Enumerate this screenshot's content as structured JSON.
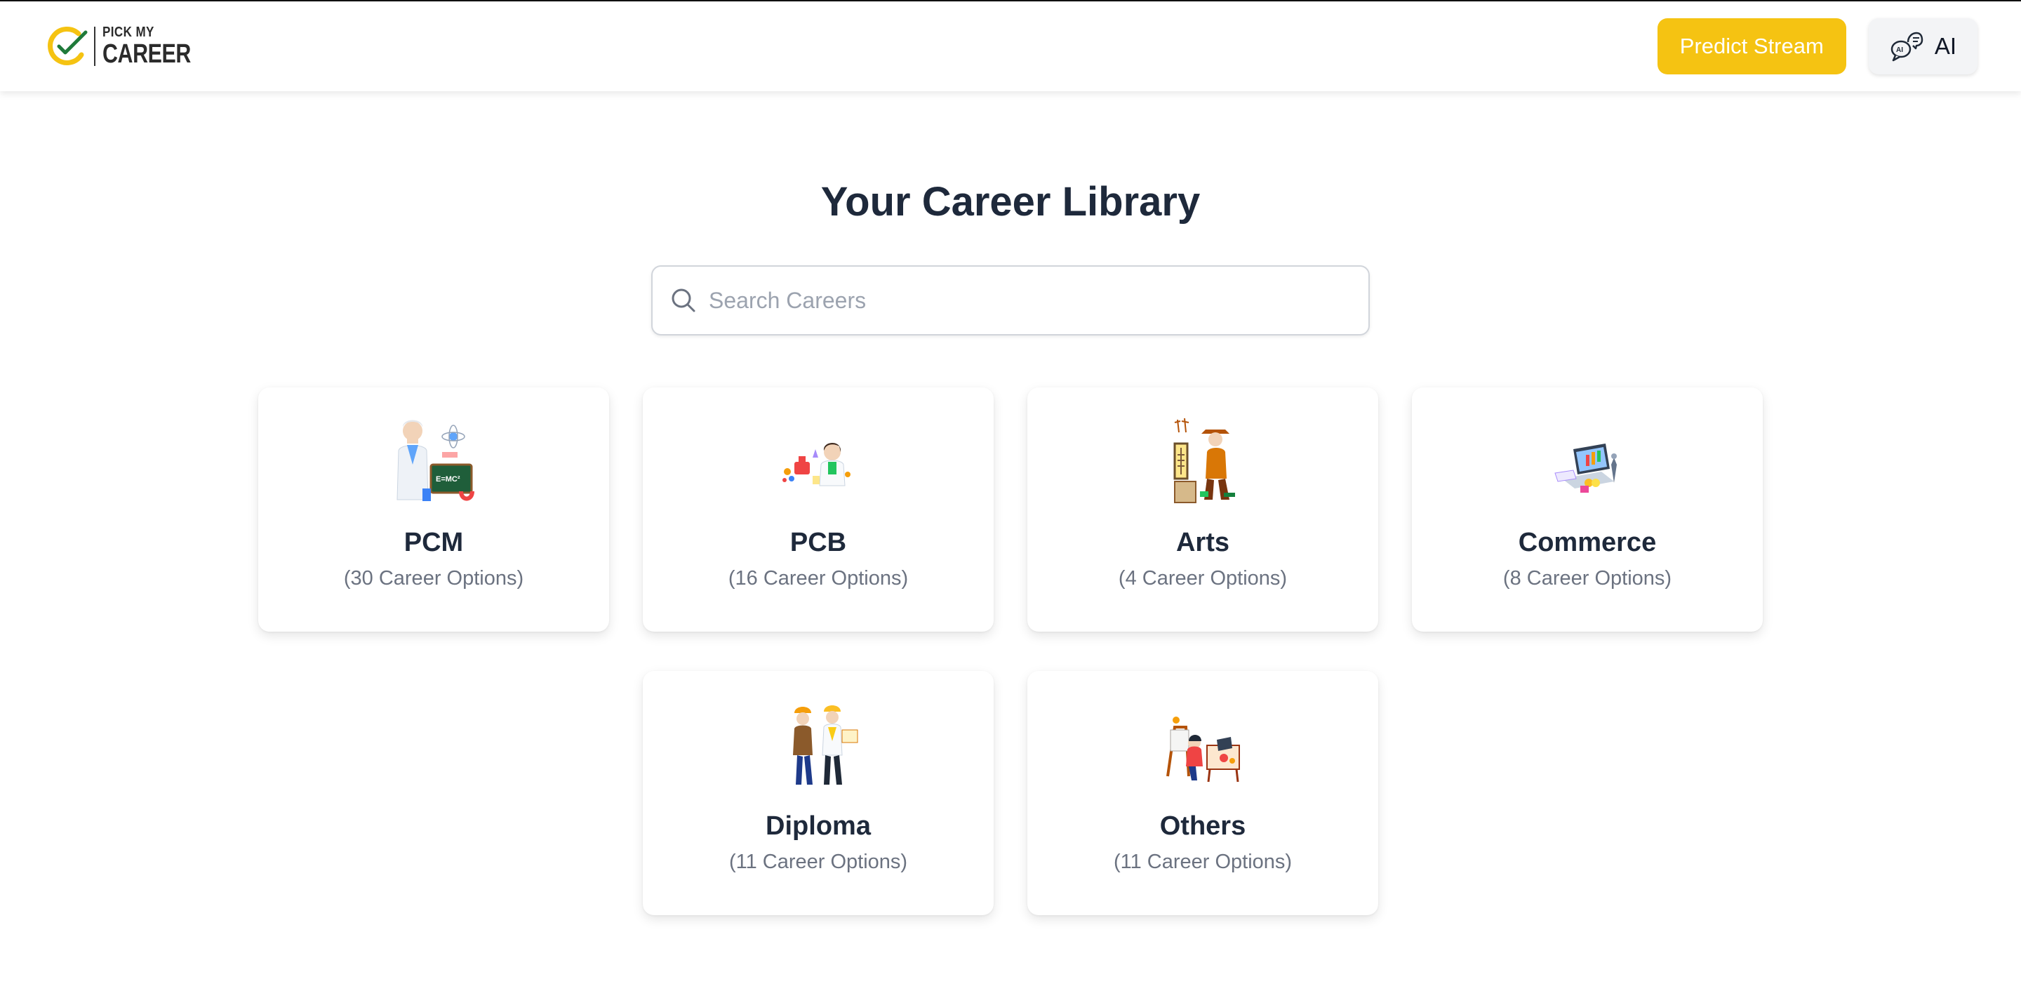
{
  "brand": {
    "logo_top": "PICK MY",
    "logo_bottom": "CAREER",
    "accent": "#f5c312"
  },
  "nav": {
    "predict_label": "Predict Stream",
    "ai_label": "AI",
    "ai_icon": "ai-chat-icon"
  },
  "main": {
    "title": "Your Career Library",
    "search": {
      "placeholder": "Search Careers",
      "value": "",
      "icon": "search-icon"
    }
  },
  "categories": [
    {
      "name": "PCM",
      "count_text": "(30 Career Options)",
      "icon": "scientist-illustration"
    },
    {
      "name": "PCB",
      "count_text": "(16 Career Options)",
      "icon": "doctor-illustration"
    },
    {
      "name": "Arts",
      "count_text": "(4 Career Options)",
      "icon": "archaeologist-illustration"
    },
    {
      "name": "Commerce",
      "count_text": "(8 Career Options)",
      "icon": "finance-laptop-illustration"
    },
    {
      "name": "Diploma",
      "count_text": "(11 Career Options)",
      "icon": "engineers-illustration"
    },
    {
      "name": "Others",
      "count_text": "(11 Career Options)",
      "icon": "designer-desk-illustration"
    }
  ]
}
